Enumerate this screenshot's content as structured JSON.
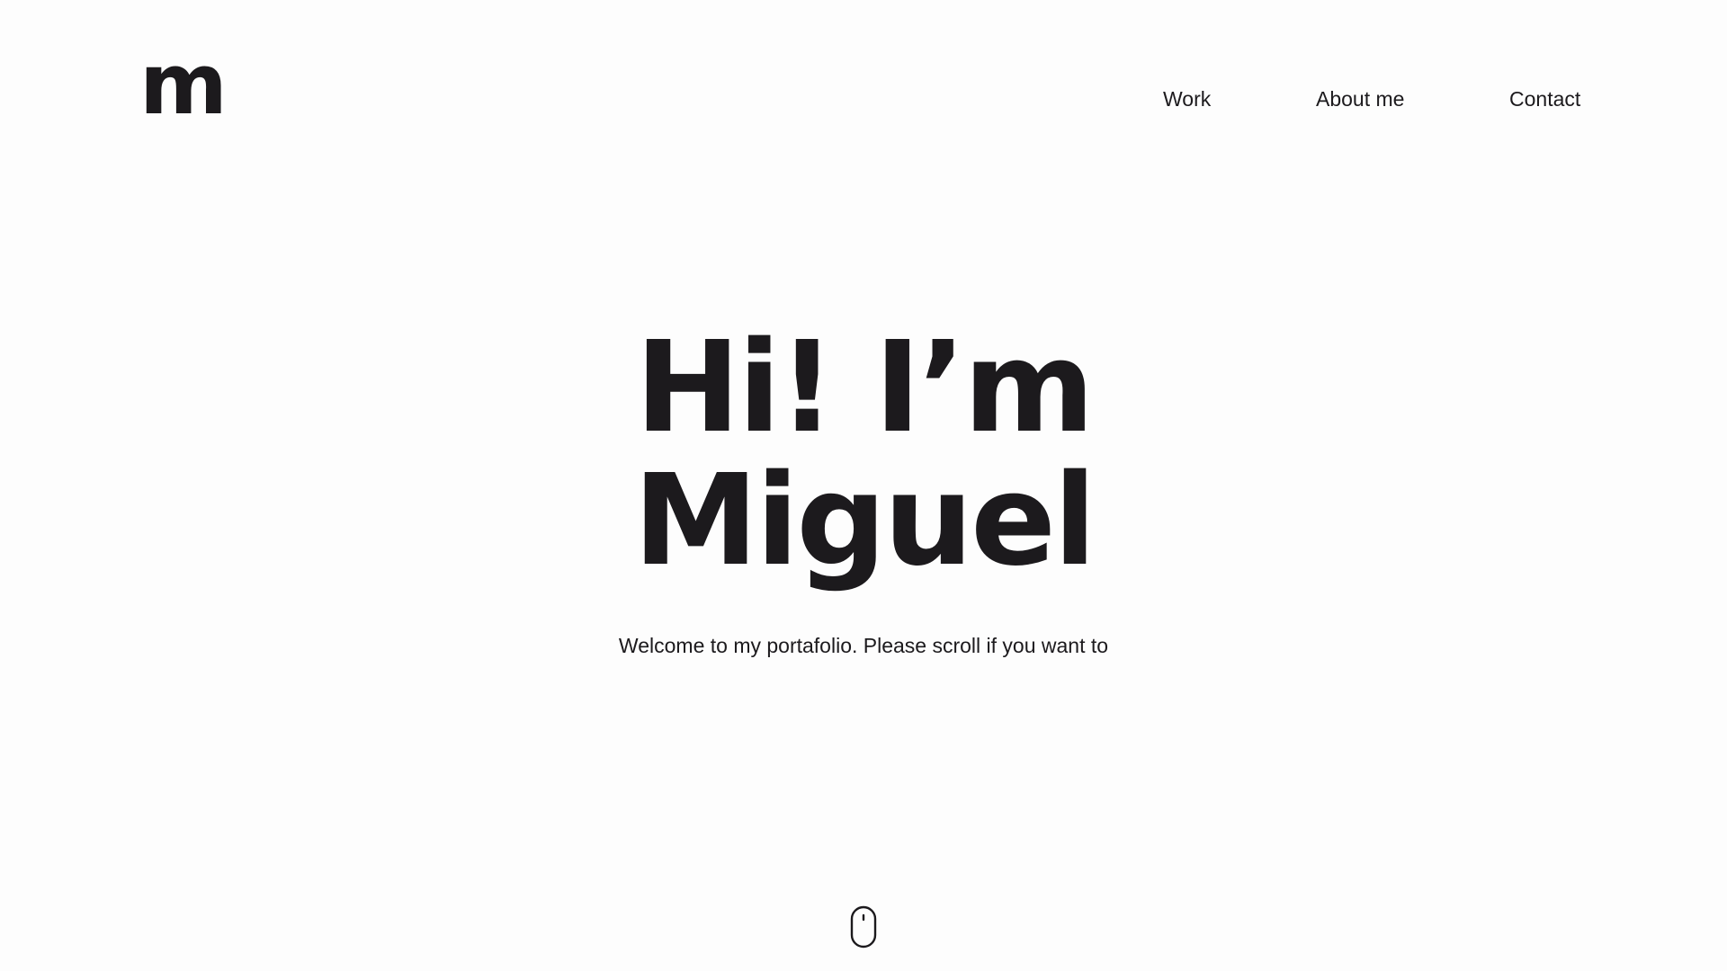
{
  "header": {
    "logo_text": "m",
    "nav": [
      {
        "label": "Work"
      },
      {
        "label": "About me"
      },
      {
        "label": "Contact"
      }
    ]
  },
  "hero": {
    "title_line1": "Hi! I’m",
    "title_line2": "Miguel",
    "subtitle": "Welcome to my portafolio. Please scroll if you want to"
  },
  "scroll_indicator": {
    "icon": "mouse-scroll-icon"
  },
  "colors": {
    "background": "#fdfdfd",
    "text": "#1c1a1d"
  }
}
